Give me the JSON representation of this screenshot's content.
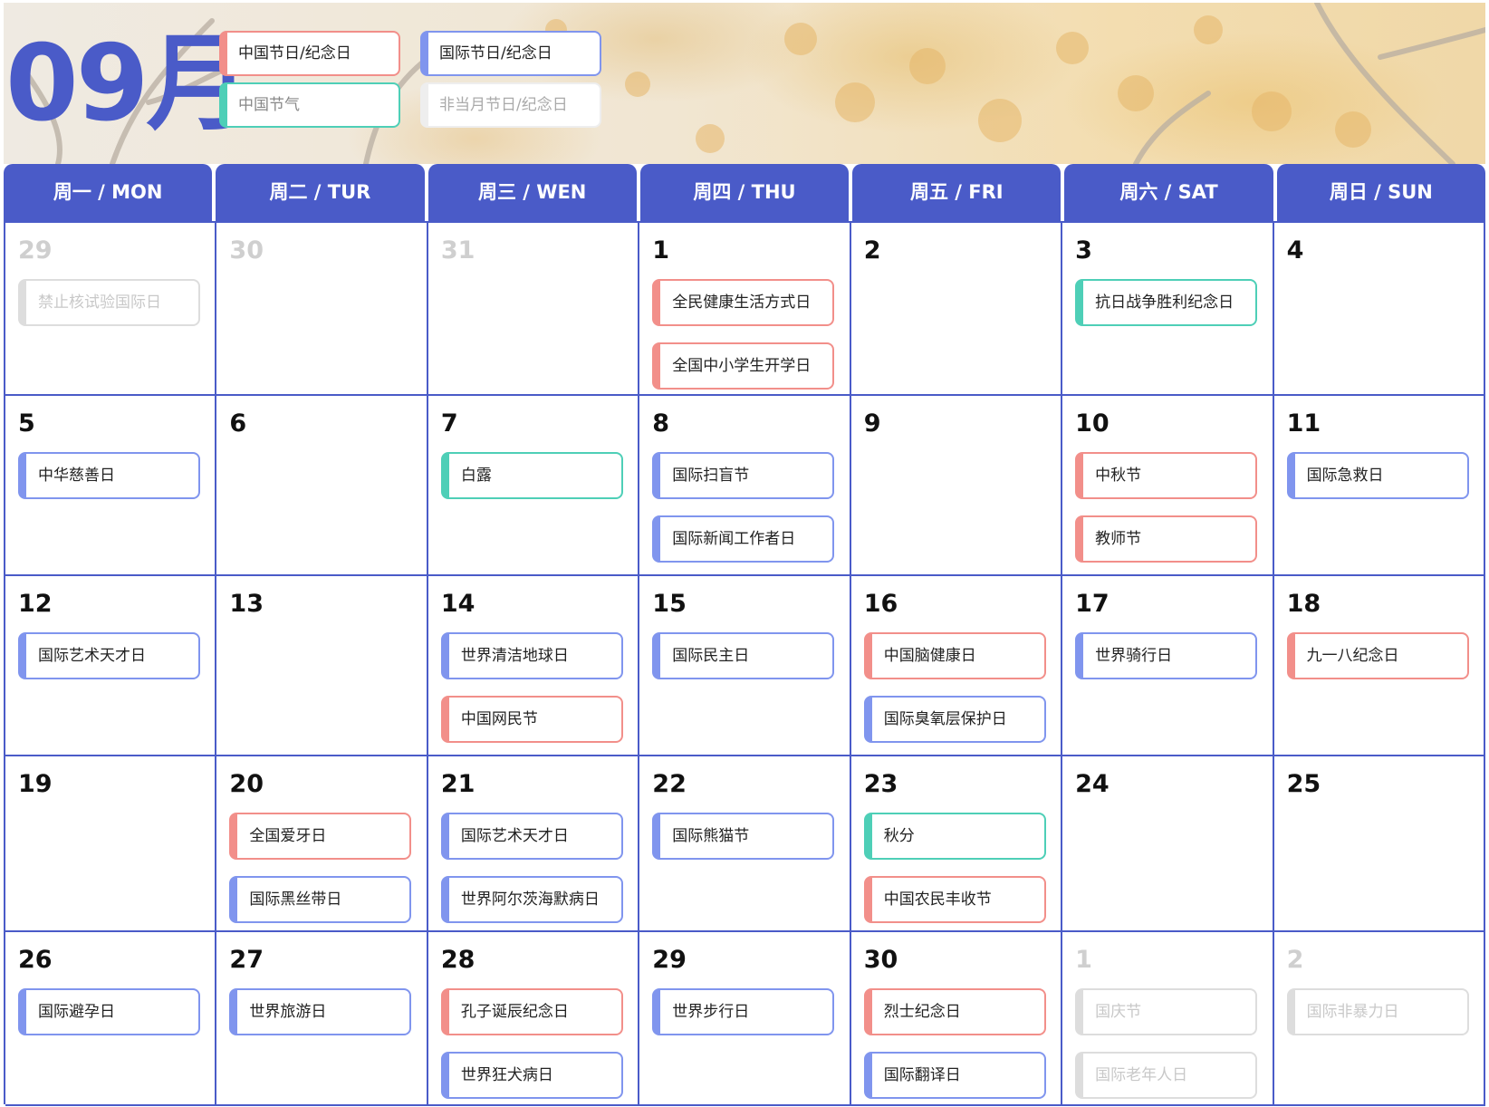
{
  "header": {
    "month_title": "09月"
  },
  "legend": [
    {
      "label": "中国节日/纪念日",
      "kind": "cn_holiday"
    },
    {
      "label": "中国节气",
      "kind": "solar_term"
    },
    {
      "label": "国际节日/纪念日",
      "kind": "intl_holiday"
    },
    {
      "label": "非当月节日/纪念日",
      "kind": "other_month"
    }
  ],
  "colors": {
    "accent": "#4a5bc8",
    "cn_holiday": "#f28f8a",
    "intl_holiday": "#8095ee",
    "solar_term": "#4ecfb7",
    "other_month": "#dddddd"
  },
  "weekdays": [
    "周一 / MON",
    "周二 / TUR",
    "周三 / WEN",
    "周四 / THU",
    "周五 / FRI",
    "周六 / SAT",
    "周日 / SUN"
  ],
  "weeks": [
    [
      {
        "day": "29",
        "other_month": true,
        "events": [
          {
            "label": "禁止核试验国际日",
            "kind": "other_month"
          }
        ]
      },
      {
        "day": "30",
        "other_month": true,
        "events": []
      },
      {
        "day": "31",
        "other_month": true,
        "events": []
      },
      {
        "day": "1",
        "events": [
          {
            "label": "全民健康生活方式日",
            "kind": "cn_holiday"
          },
          {
            "label": "全国中小学生开学日",
            "kind": "cn_holiday"
          }
        ]
      },
      {
        "day": "2",
        "events": []
      },
      {
        "day": "3",
        "events": [
          {
            "label": "抗日战争胜利纪念日",
            "kind": "solar_term"
          }
        ]
      },
      {
        "day": "4",
        "events": []
      }
    ],
    [
      {
        "day": "5",
        "events": [
          {
            "label": "中华慈善日",
            "kind": "intl_holiday"
          }
        ]
      },
      {
        "day": "6",
        "events": []
      },
      {
        "day": "7",
        "events": [
          {
            "label": "白露",
            "kind": "solar_term"
          }
        ]
      },
      {
        "day": "8",
        "events": [
          {
            "label": "国际扫盲节",
            "kind": "intl_holiday"
          },
          {
            "label": "国际新闻工作者日",
            "kind": "intl_holiday"
          }
        ]
      },
      {
        "day": "9",
        "events": []
      },
      {
        "day": "10",
        "events": [
          {
            "label": "中秋节",
            "kind": "cn_holiday"
          },
          {
            "label": "教师节",
            "kind": "cn_holiday"
          }
        ]
      },
      {
        "day": "11",
        "events": [
          {
            "label": "国际急救日",
            "kind": "intl_holiday"
          }
        ]
      }
    ],
    [
      {
        "day": "12",
        "events": [
          {
            "label": "国际艺术天才日",
            "kind": "intl_holiday"
          }
        ]
      },
      {
        "day": "13",
        "events": []
      },
      {
        "day": "14",
        "events": [
          {
            "label": "世界清洁地球日",
            "kind": "intl_holiday"
          },
          {
            "label": "中国网民节",
            "kind": "cn_holiday"
          }
        ]
      },
      {
        "day": "15",
        "events": [
          {
            "label": "国际民主日",
            "kind": "intl_holiday"
          }
        ]
      },
      {
        "day": "16",
        "events": [
          {
            "label": "中国脑健康日",
            "kind": "cn_holiday"
          },
          {
            "label": "国际臭氧层保护日",
            "kind": "intl_holiday"
          }
        ]
      },
      {
        "day": "17",
        "events": [
          {
            "label": "世界骑行日",
            "kind": "intl_holiday"
          }
        ]
      },
      {
        "day": "18",
        "events": [
          {
            "label": "九一八纪念日",
            "kind": "cn_holiday"
          }
        ]
      }
    ],
    [
      {
        "day": "19",
        "events": []
      },
      {
        "day": "20",
        "events": [
          {
            "label": "全国爱牙日",
            "kind": "cn_holiday"
          },
          {
            "label": "国际黑丝带日",
            "kind": "intl_holiday"
          }
        ]
      },
      {
        "day": "21",
        "events": [
          {
            "label": "国际艺术天才日",
            "kind": "intl_holiday"
          },
          {
            "label": "世界阿尔茨海默病日",
            "kind": "intl_holiday"
          }
        ]
      },
      {
        "day": "22",
        "events": [
          {
            "label": "国际熊猫节",
            "kind": "intl_holiday"
          }
        ]
      },
      {
        "day": "23",
        "events": [
          {
            "label": "秋分",
            "kind": "solar_term"
          },
          {
            "label": "中国农民丰收节",
            "kind": "cn_holiday"
          }
        ]
      },
      {
        "day": "24",
        "events": []
      },
      {
        "day": "25",
        "events": []
      }
    ],
    [
      {
        "day": "26",
        "events": [
          {
            "label": "国际避孕日",
            "kind": "intl_holiday"
          }
        ]
      },
      {
        "day": "27",
        "events": [
          {
            "label": "世界旅游日",
            "kind": "intl_holiday"
          }
        ]
      },
      {
        "day": "28",
        "events": [
          {
            "label": "孔子诞辰纪念日",
            "kind": "cn_holiday"
          },
          {
            "label": "世界狂犬病日",
            "kind": "intl_holiday"
          }
        ]
      },
      {
        "day": "29",
        "events": [
          {
            "label": "世界步行日",
            "kind": "intl_holiday"
          }
        ]
      },
      {
        "day": "30",
        "events": [
          {
            "label": "烈士纪念日",
            "kind": "cn_holiday"
          },
          {
            "label": "国际翻译日",
            "kind": "intl_holiday"
          }
        ]
      },
      {
        "day": "1",
        "other_month": true,
        "events": [
          {
            "label": "国庆节",
            "kind": "other_month"
          },
          {
            "label": "国际老年人日",
            "kind": "other_month"
          }
        ]
      },
      {
        "day": "2",
        "other_month": true,
        "events": [
          {
            "label": "国际非暴力日",
            "kind": "other_month"
          }
        ]
      }
    ]
  ]
}
